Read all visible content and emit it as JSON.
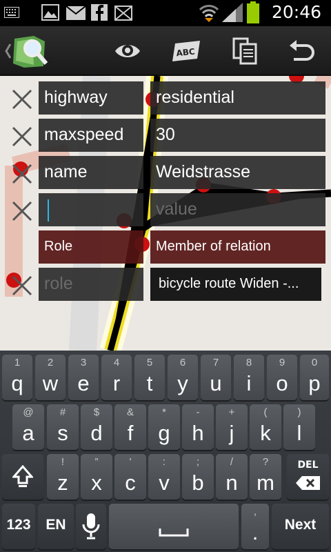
{
  "status_bar": {
    "time": "20:46",
    "icons": [
      "keyboard-icon",
      "image-icon",
      "email-icon",
      "facebook-icon",
      "message-icon",
      "wifi-icon",
      "signal-icon",
      "battery-icon"
    ]
  },
  "action_bar": {
    "icons": [
      "app-logo-icon",
      "eye-icon",
      "abc-icon",
      "copy-icon",
      "undo-icon"
    ]
  },
  "tags": [
    {
      "key": "highway",
      "value": "residential"
    },
    {
      "key": "maxspeed",
      "value": "30"
    },
    {
      "key": "name",
      "value": "Weidstrasse"
    },
    {
      "key": "",
      "value": "",
      "value_placeholder": "value"
    }
  ],
  "relation": {
    "role_header": "Role",
    "member_header": "Member of relation",
    "role_placeholder": "role",
    "member_value": "bicycle route Widen -..."
  },
  "keyboard": {
    "row1": [
      {
        "hint": "1",
        "key": "q"
      },
      {
        "hint": "2",
        "key": "w"
      },
      {
        "hint": "3",
        "key": "e"
      },
      {
        "hint": "4",
        "key": "r"
      },
      {
        "hint": "5",
        "key": "t"
      },
      {
        "hint": "6",
        "key": "y"
      },
      {
        "hint": "7",
        "key": "u"
      },
      {
        "hint": "8",
        "key": "i"
      },
      {
        "hint": "9",
        "key": "o"
      },
      {
        "hint": "0",
        "key": "p"
      }
    ],
    "row2": [
      {
        "hint": "@",
        "key": "a"
      },
      {
        "hint": "#",
        "key": "s"
      },
      {
        "hint": "$",
        "key": "d"
      },
      {
        "hint": "&",
        "key": "f"
      },
      {
        "hint": "*",
        "key": "g"
      },
      {
        "hint": "-",
        "key": "h"
      },
      {
        "hint": "+",
        "key": "j"
      },
      {
        "hint": "(",
        "key": "k"
      },
      {
        "hint": ")",
        "key": "l"
      }
    ],
    "row3": [
      {
        "hint": "!",
        "key": "z"
      },
      {
        "hint": "”",
        "key": "x"
      },
      {
        "hint": "'",
        "key": "c"
      },
      {
        "hint": ":",
        "key": "v"
      },
      {
        "hint": ";",
        "key": "b"
      },
      {
        "hint": "/",
        "key": "n"
      },
      {
        "hint": "?",
        "key": "m"
      }
    ],
    "del_label": "DEL",
    "symbols_label": "123",
    "language_label": "EN",
    "comma_label": ",",
    "period_label": ".",
    "next_label": "Next"
  },
  "colors": {
    "accent": "#33b5e5",
    "relation_header_bg": "#551414",
    "battery": "#99cc00"
  }
}
